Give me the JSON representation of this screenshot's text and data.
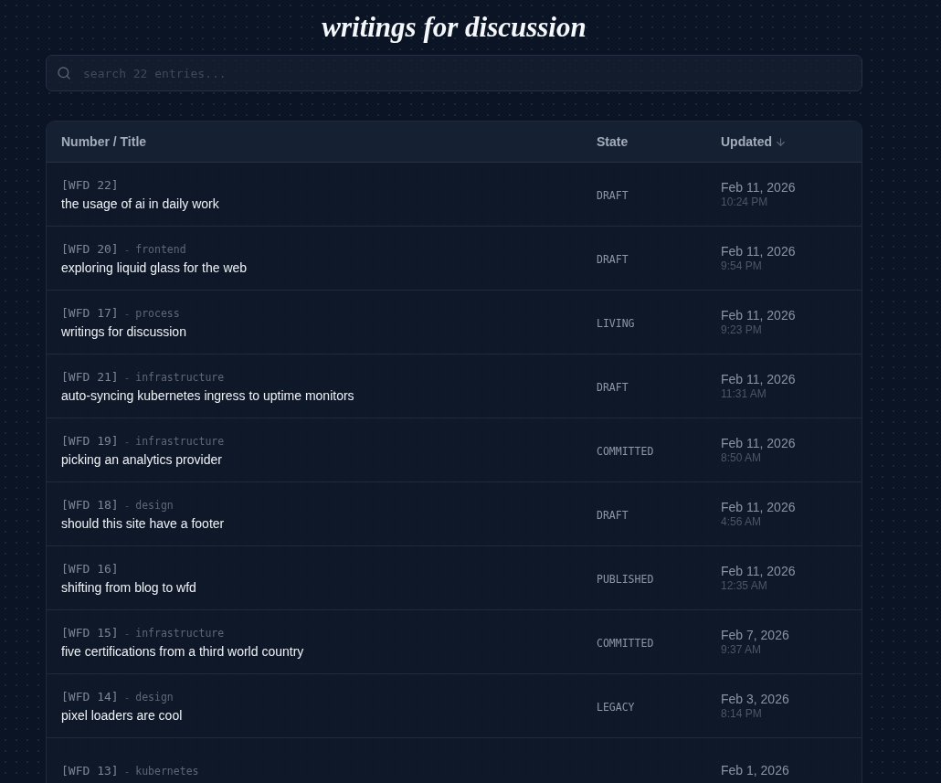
{
  "title": "writings for discussion",
  "search": {
    "placeholder": "search 22 entries..."
  },
  "table": {
    "columns": [
      {
        "label": "Number / Title",
        "sorted": false
      },
      {
        "label": "State",
        "sorted": false
      },
      {
        "label": "Updated",
        "sorted": true
      }
    ],
    "rows": [
      {
        "number": "[WFD 22]",
        "title": "the usage of ai in daily work",
        "state": "DRAFT",
        "date": "Feb 11, 2026",
        "time": "10:24 PM"
      },
      {
        "number": "[WFD 20]",
        "separator": "-",
        "tag": "frontend",
        "title": "exploring liquid glass for the web",
        "state": "DRAFT",
        "date": "Feb 11, 2026",
        "time": "9:54 PM"
      },
      {
        "number": "[WFD 17]",
        "separator": "-",
        "tag": "process",
        "title": "writings for discussion",
        "state": "LIVING",
        "date": "Feb 11, 2026",
        "time": "9:23 PM"
      },
      {
        "number": "[WFD 21]",
        "separator": "-",
        "tag": "infrastructure",
        "title": "auto-syncing kubernetes ingress to uptime monitors",
        "state": "DRAFT",
        "date": "Feb 11, 2026",
        "time": "11:31 AM"
      },
      {
        "number": "[WFD 19]",
        "separator": "-",
        "tag": "infrastructure",
        "title": "picking an analytics provider",
        "state": "COMMITTED",
        "date": "Feb 11, 2026",
        "time": "8:50 AM"
      },
      {
        "number": "[WFD 18]",
        "separator": "-",
        "tag": "design",
        "title": "should this site have a footer",
        "state": "DRAFT",
        "date": "Feb 11, 2026",
        "time": "4:56 AM"
      },
      {
        "number": "[WFD 16]",
        "title": "shifting from blog to wfd",
        "state": "PUBLISHED",
        "date": "Feb 11, 2026",
        "time": "12:35 AM"
      },
      {
        "number": "[WFD 15]",
        "separator": "-",
        "tag": "infrastructure",
        "title": "five certifications from a third world country",
        "state": "COMMITTED",
        "date": "Feb 7, 2026",
        "time": "9:37 AM"
      },
      {
        "number": "[WFD 14]",
        "separator": "-",
        "tag": "design",
        "title": "pixel loaders are cool",
        "state": "LEGACY",
        "date": "Feb 3, 2026",
        "time": "8:14 PM"
      },
      {
        "number": "[WFD 13]",
        "separator": "-",
        "tag": "kubernetes",
        "date": "Feb 1, 2026"
      }
    ]
  }
}
